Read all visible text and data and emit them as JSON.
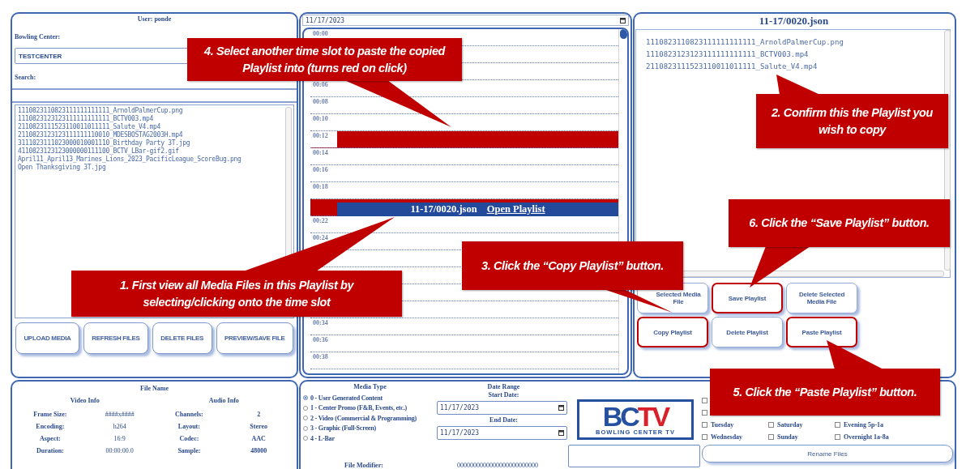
{
  "user_label": "User: ponde",
  "bowling_center": {
    "label": "Bowling Center:",
    "value": "TESTCENTER"
  },
  "search": {
    "label": "Search:"
  },
  "media_files": [
    "1110823110823111111111111_ArnoldPalmerCup.png",
    "1110823123123111111111111_BCTV003.mp4",
    "2110823111523110011011111_Salute_V4.mp4",
    "2110823123123111111110010_MDESBOSTAG2003H.mp4",
    "3111023111023000010001110_Birthday Party 3T.jpg",
    "4110823123123000000111100_BCTV_LBar-gif2.gif",
    "April11_April13_Marines_Lions_2023_PacificLeague_ScoreBug.png",
    "Open Thanksgiving 3T.jpg"
  ],
  "media_buttons": [
    "UPLOAD MEDIA",
    "REFRESH FILES",
    "DELETE FILES",
    "PREVIEW/SAVE FILE"
  ],
  "schedule": {
    "date": "11/17/2023",
    "slots": [
      {
        "time": "00:00",
        "kind": "empty",
        "selected": false
      },
      {
        "kind": "empty",
        "selected": false
      },
      {
        "kind": "empty",
        "selected": false
      },
      {
        "time": "00:06",
        "kind": "empty",
        "selected": false
      },
      {
        "time": "00:08",
        "kind": "empty",
        "selected": false
      },
      {
        "time": "00:10",
        "kind": "empty",
        "selected": false
      },
      {
        "time": "00:12",
        "kind": "empty",
        "selected": true
      },
      {
        "time": "00:14",
        "kind": "empty",
        "selected": false
      },
      {
        "time": "00:16",
        "kind": "empty",
        "selected": false
      },
      {
        "time": "00:18",
        "kind": "empty",
        "selected": false
      },
      {
        "kind": "playlist",
        "selected": true,
        "file": "11-17/0020.json",
        "link": "Open Playlist"
      },
      {
        "time": "00:22",
        "kind": "empty",
        "selected": false
      },
      {
        "time": "00:24",
        "kind": "empty",
        "selected": false
      },
      {
        "kind": "empty",
        "selected": false
      },
      {
        "kind": "empty",
        "selected": false
      },
      {
        "kind": "empty",
        "selected": false
      },
      {
        "kind": "empty",
        "selected": false
      },
      {
        "time": "00:34",
        "kind": "empty",
        "selected": false
      },
      {
        "time": "00:36",
        "kind": "empty",
        "selected": false
      },
      {
        "time": "00:38",
        "kind": "empty",
        "selected": false
      }
    ]
  },
  "playlist": {
    "title": "11-17/0020.json",
    "files": [
      "1110823110823111111111111_ArnoldPalmerCup.png",
      "1110823123123111111111111_BCTV003.mp4",
      "2110823111523110011011111_Salute_V4.mp4"
    ],
    "buttons": [
      {
        "label": "Selected Media File",
        "emphasized": false
      },
      {
        "label": "Save Playlist",
        "emphasized": true
      },
      {
        "label": "Delete Selected Media File",
        "emphasized": false
      },
      {
        "label": "Copy Playlist",
        "emphasized": true
      },
      {
        "label": "Delete Playlist",
        "emphasized": false
      },
      {
        "label": "Paste Playlist",
        "emphasized": true
      }
    ]
  },
  "file_info": {
    "title": "File Name",
    "video_heading": "Video Info",
    "audio_heading": "Audio Info",
    "rows": [
      {
        "video_label": "Frame Size:",
        "video_value": "####x####",
        "audio_label": "Channels:",
        "audio_value": "2"
      },
      {
        "video_label": "Encoding:",
        "video_value": "h264",
        "audio_label": "Layout:",
        "audio_value": "Stereo"
      },
      {
        "video_label": "Aspect:",
        "video_value": "16:9",
        "audio_label": "Codec:",
        "audio_value": "AAC"
      },
      {
        "video_label": "Duration:",
        "video_value": "00:00:00.0",
        "audio_label": "Sample:",
        "audio_value": "48000"
      }
    ]
  },
  "media_type": {
    "title": "Media Type",
    "options": [
      {
        "label": "0 - User Generated Content",
        "selected": true
      },
      {
        "label": "1 - Center Promo (F&B, Events, etc.)",
        "selected": false
      },
      {
        "label": "2 - Video (Commercial & Programming)",
        "selected": false
      },
      {
        "label": "3 - Graphic (Full-Screen)",
        "selected": false
      },
      {
        "label": "4 - L-Bar",
        "selected": false
      }
    ]
  },
  "date_range": {
    "title": "Date Range",
    "start_label": "Start Date:",
    "start": "11/17/2023",
    "end_label": "End Date:",
    "end": "11/17/2023"
  },
  "logo": {
    "main": "BC",
    "accent": "TV",
    "tagline": "BOWLING CENTER TV"
  },
  "day_rows": [
    {
      "items": [
        {
          "checked": false
        }
      ]
    },
    {
      "items": [
        {
          "checked": false
        }
      ]
    },
    {
      "items": [
        {
          "label": "Tuesday",
          "checked": false
        },
        {
          "label": "Saturday",
          "checked": false
        },
        {
          "label": "Evening 5p-1a",
          "checked": false
        }
      ]
    },
    {
      "items": [
        {
          "label": "Wednesday",
          "checked": false
        },
        {
          "label": "Sunday",
          "checked": false
        },
        {
          "label": "Overnight 1a-8a",
          "checked": false
        }
      ]
    }
  ],
  "file_modifier": {
    "label": "File Modifier:",
    "value": "0000000000000000000000000"
  },
  "rename_button": "Rename Files",
  "callouts": [
    {
      "text": "4. Select another time slot to paste the copied Playlist into (turns red on click)"
    },
    {
      "text": "2. Confirm this the Playlist you wish to copy"
    },
    {
      "text": "6. Click the “Save Playlist” button."
    },
    {
      "text": "3. Click the “Copy Playlist” button."
    },
    {
      "text": "1. First view all Media Files in this Playlist by selecting/clicking onto the time slot"
    },
    {
      "text": "5. Click the “Paste Playlist” button."
    }
  ]
}
